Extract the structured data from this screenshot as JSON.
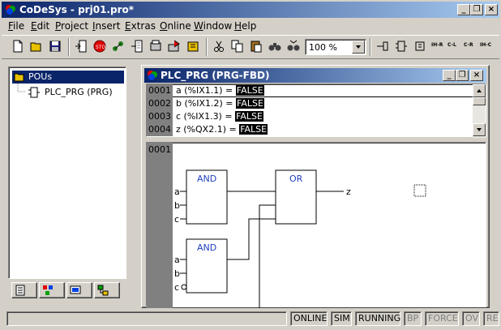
{
  "window": {
    "title": "CoDeSys - prj01.pro*"
  },
  "menu": [
    {
      "label": "File",
      "ul": "F",
      "rest": "ile"
    },
    {
      "label": "Edit",
      "ul": "E",
      "rest": "dit"
    },
    {
      "label": "Project",
      "ul": "P",
      "rest": "roject"
    },
    {
      "label": "Insert",
      "ul": "I",
      "rest": "nsert"
    },
    {
      "label": "Extras",
      "ul": "E",
      "rest": "xtras"
    },
    {
      "label": "Online",
      "ul": "O",
      "rest": "nline"
    },
    {
      "label": "Window",
      "ul": "W",
      "rest": "indow"
    },
    {
      "label": "Help",
      "ul": "H",
      "rest": "elp"
    }
  ],
  "toolbar": {
    "zoom": "100 %",
    "fbd_buttons": [
      "IH-R",
      "C-L",
      "C-R",
      "IH-C"
    ]
  },
  "tree": {
    "root": "POUs",
    "child": "PLC_PRG (PRG)"
  },
  "editor": {
    "title": "PLC_PRG (PRG-FBD)",
    "decl": [
      {
        "no": "0001",
        "text": "a (%IX1.1) = ",
        "value": "FALSE"
      },
      {
        "no": "0002",
        "text": "b (%IX1.2) = ",
        "value": "FALSE"
      },
      {
        "no": "0003",
        "text": "c (%IX1.3) = ",
        "value": "FALSE"
      },
      {
        "no": "0004",
        "text": "z (%QX2.1) = ",
        "value": "FALSE"
      }
    ],
    "network_no": "0001",
    "blocks": {
      "and1": "AND",
      "or1": "OR",
      "and2": "AND"
    },
    "inputs": {
      "a1": "a",
      "b1": "b",
      "c1": "c",
      "a2": "a",
      "b2": "b",
      "c2": "c"
    },
    "output": "z"
  },
  "status": [
    "ONLINE",
    "SIM",
    "RUNNING",
    "BP",
    "FORCE",
    "OV",
    "READ"
  ],
  "colors": {
    "titlebar": "#0a246a",
    "face": "#d4d0c8",
    "fbd_text": "#1f3fbf"
  }
}
